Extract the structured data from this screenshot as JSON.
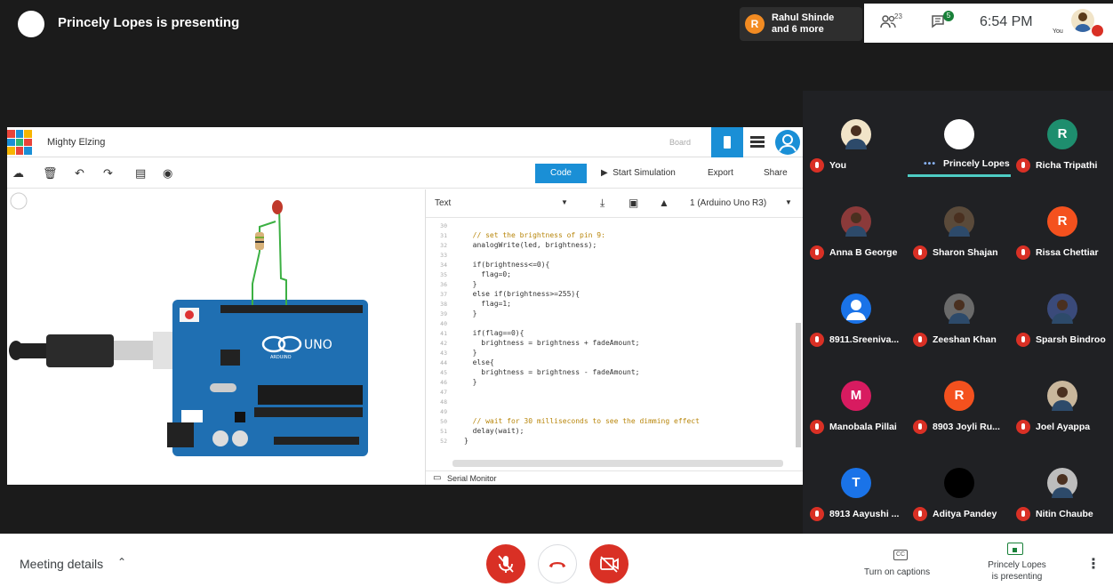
{
  "presenter": {
    "text": "Princely Lopes is presenting"
  },
  "top_right": {
    "speaker_initial": "R",
    "speaker_line1": "Rahul Shinde",
    "speaker_line2": "and 6 more",
    "people_count": "23",
    "chat_badge": "5",
    "time": "6:54 PM",
    "you_label": "You"
  },
  "tinkercad": {
    "title": "Mighty Elzing",
    "board_label": "Board",
    "code_button": "Code",
    "simulate_button": "Start Simulation",
    "export_button": "Export",
    "share_button": "Share",
    "code_mode": "Text",
    "device": "1 (Arduino Uno R3)",
    "serial_monitor": "Serial Monitor",
    "board_brand": "UNO",
    "board_brand_sub": "ARDUINO",
    "code_lines": [
      {
        "n": "30",
        "t": "",
        "comment": false
      },
      {
        "n": "31",
        "t": "  // set the brightness of pin 9:",
        "comment": true
      },
      {
        "n": "32",
        "t": "  analogWrite(led, brightness);",
        "comment": false
      },
      {
        "n": "33",
        "t": "",
        "comment": false
      },
      {
        "n": "34",
        "t": "  if(brightness<=0){",
        "comment": false
      },
      {
        "n": "35",
        "t": "    flag=0;",
        "comment": false
      },
      {
        "n": "36",
        "t": "  }",
        "comment": false
      },
      {
        "n": "37",
        "t": "  else if(brightness>=255){",
        "comment": false
      },
      {
        "n": "38",
        "t": "    flag=1;",
        "comment": false
      },
      {
        "n": "39",
        "t": "  }",
        "comment": false
      },
      {
        "n": "40",
        "t": "",
        "comment": false
      },
      {
        "n": "41",
        "t": "  if(flag==0){",
        "comment": false
      },
      {
        "n": "42",
        "t": "    brightness = brightness + fadeAmount;",
        "comment": false
      },
      {
        "n": "43",
        "t": "  }",
        "comment": false
      },
      {
        "n": "44",
        "t": "  else{",
        "comment": false
      },
      {
        "n": "45",
        "t": "    brightness = brightness - fadeAmount;",
        "comment": false
      },
      {
        "n": "46",
        "t": "  }",
        "comment": false
      },
      {
        "n": "47",
        "t": "",
        "comment": false
      },
      {
        "n": "48",
        "t": "",
        "comment": false
      },
      {
        "n": "49",
        "t": "",
        "comment": false
      },
      {
        "n": "50",
        "t": "  // wait for 30 milliseconds to see the dimming effect",
        "comment": true
      },
      {
        "n": "51",
        "t": "  delay(wait);",
        "comment": false
      },
      {
        "n": "52",
        "t": "}",
        "comment": false
      }
    ]
  },
  "participants": [
    {
      "name": "You",
      "initial": "",
      "color": "#f1e4c8",
      "photo": true,
      "presenting": false
    },
    {
      "name": "Princely Lopes",
      "initial": "",
      "color": "#ffffff",
      "photo": false,
      "presenting": true
    },
    {
      "name": "Richa Tripathi",
      "initial": "R",
      "color": "#1e8e6e",
      "photo": false,
      "presenting": false
    },
    {
      "name": "Anna B George",
      "initial": "",
      "color": "#8b3a3a",
      "photo": true,
      "presenting": false
    },
    {
      "name": "Sharon Shajan",
      "initial": "",
      "color": "#5a4a3a",
      "photo": true,
      "presenting": false
    },
    {
      "name": "Rissa Chettiar",
      "initial": "R",
      "color": "#f4511e",
      "photo": false,
      "presenting": false
    },
    {
      "name": "8911.Sreeniva...",
      "initial": "",
      "color": "#1a73e8",
      "photo": false,
      "presenting": false,
      "generic": true
    },
    {
      "name": "Zeeshan Khan",
      "initial": "",
      "color": "#6a6a6a",
      "photo": true,
      "presenting": false
    },
    {
      "name": "Sparsh Bindroo",
      "initial": "",
      "color": "#3a4a7a",
      "photo": true,
      "presenting": false
    },
    {
      "name": "Manobala Pillai",
      "initial": "M",
      "color": "#d81b60",
      "photo": false,
      "presenting": false
    },
    {
      "name": "8903 Joyli Ru...",
      "initial": "R",
      "color": "#f4511e",
      "photo": false,
      "presenting": false
    },
    {
      "name": "Joel Ayappa",
      "initial": "",
      "color": "#c9b79c",
      "photo": true,
      "presenting": false
    },
    {
      "name": "8913 Aayushi ...",
      "initial": "T",
      "color": "#1a73e8",
      "photo": false,
      "presenting": false
    },
    {
      "name": "Aditya Pandey",
      "initial": "",
      "color": "#000000",
      "photo": false,
      "presenting": false
    },
    {
      "name": "Nitin Chaube",
      "initial": "",
      "color": "#bdbdbd",
      "photo": true,
      "presenting": false
    }
  ],
  "bottom": {
    "meeting_details": "Meeting details",
    "captions_label": "Turn on captions",
    "cc_glyph": "CC",
    "present_line1": "Princely Lopes",
    "present_line2": "is presenting"
  },
  "colors": {
    "mute_red": "#d93025",
    "tinkercad_blue": "#1a8fd6",
    "panel_bg": "#202124"
  }
}
